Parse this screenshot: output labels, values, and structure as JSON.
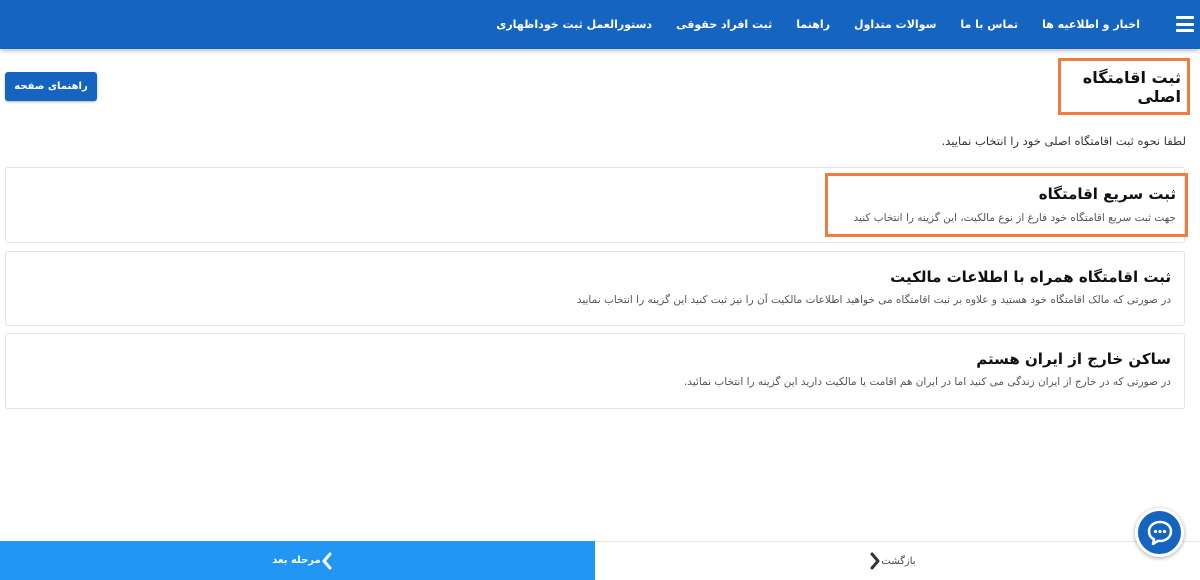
{
  "navbar": {
    "items": [
      "اخبار و اطلاعیه ها",
      "تماس با ما",
      "سوالات متداول",
      "راهنما",
      "ثبت افراد حقوقی",
      "دستورالعمل ثبت خوداظهاری"
    ]
  },
  "header": {
    "title": "ثبت اقامتگاه اصلی",
    "help_button": "راهنمای صفحه"
  },
  "instruction": "لطفا نحوه ثبت اقامتگاه اصلی خود را انتخاب نمایید.",
  "options": [
    {
      "title": "ثبت سریع اقامتگاه",
      "description": "جهت ثبت سریع اقامتگاه خود فارغ از نوع مالکیت، این گزینه را انتخاب کنید"
    },
    {
      "title": "ثبت اقامتگاه همراه با اطلاعات مالکیت",
      "description": "در صورتی که مالک اقامتگاه خود هستید و علاوه بر ثبت اقامتگاه می خواهید اطلاعات مالکیت آن را نیز ثبت کنید این گزینه را انتخاب نمایید"
    },
    {
      "title": "ساکن خارج از ایران هستم",
      "description": "در صورتی که در خارج از ایران زندگی می کنید اما در ایران هم اقامت یا مالکیت دارید این گزینه را انتخاب نمائید."
    }
  ],
  "footer": {
    "next_label": "مرحله بعد",
    "back_label": "بازگشت"
  },
  "colors": {
    "primary": "#1565c0",
    "next_bar": "#2196f3",
    "highlight": "#f07d3e"
  }
}
